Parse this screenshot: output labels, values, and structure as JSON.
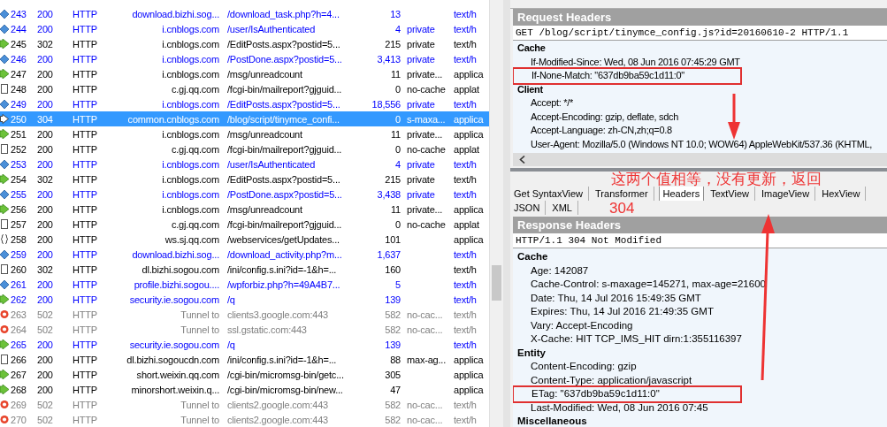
{
  "sessions": {
    "rows": [
      {
        "num": "243",
        "result": "200",
        "protocol": "HTTP",
        "host": "download.bizhi.sog...",
        "url": "/download_task.php?h=4...",
        "body": "13",
        "caching": "",
        "content_type": "text/h",
        "color": "#0000ff",
        "kind": "diamond",
        "selected": false
      },
      {
        "num": "244",
        "result": "200",
        "protocol": "HTTP",
        "host": "i.cnblogs.com",
        "url": "/user/IsAuthenticated",
        "body": "4",
        "caching": "private",
        "content_type": "text/h",
        "color": "#0000ff",
        "kind": "diamond",
        "selected": false
      },
      {
        "num": "245",
        "result": "302",
        "protocol": "HTTP",
        "host": "i.cnblogs.com",
        "url": "/EditPosts.aspx?postid=5...",
        "body": "215",
        "caching": "private",
        "content_type": "text/h",
        "color": "#000000",
        "kind": "green",
        "selected": false
      },
      {
        "num": "246",
        "result": "200",
        "protocol": "HTTP",
        "host": "i.cnblogs.com",
        "url": "/PostDone.aspx?postid=5...",
        "body": "3,413",
        "caching": "private",
        "content_type": "text/h",
        "color": "#0000ff",
        "kind": "diamond",
        "selected": false
      },
      {
        "num": "247",
        "result": "200",
        "protocol": "HTTP",
        "host": "i.cnblogs.com",
        "url": "/msg/unreadcount",
        "body": "11",
        "caching": "private...",
        "content_type": "applica",
        "color": "#000000",
        "kind": "green",
        "selected": false
      },
      {
        "num": "248",
        "result": "200",
        "protocol": "HTTP",
        "host": "c.gj.qq.com",
        "url": "/fcgi-bin/mailreport?gjguid...",
        "body": "0",
        "caching": "no-cache",
        "content_type": "applat",
        "color": "#000000",
        "kind": "page",
        "selected": false
      },
      {
        "num": "249",
        "result": "200",
        "protocol": "HTTP",
        "host": "i.cnblogs.com",
        "url": "/EditPosts.aspx?postid=5...",
        "body": "18,556",
        "caching": "private",
        "content_type": "text/h",
        "color": "#0000ff",
        "kind": "diamond",
        "selected": false
      },
      {
        "num": "250",
        "result": "304",
        "protocol": "HTTP",
        "host": "common.cnblogs.com",
        "url": "/blog/script/tinymce_confi...",
        "body": "0",
        "caching": "s-maxa...",
        "content_type": "applica",
        "kind": "outline",
        "selected": true
      },
      {
        "num": "251",
        "result": "200",
        "protocol": "HTTP",
        "host": "i.cnblogs.com",
        "url": "/msg/unreadcount",
        "body": "11",
        "caching": "private...",
        "content_type": "applica",
        "color": "#000000",
        "kind": "green",
        "selected": false
      },
      {
        "num": "252",
        "result": "200",
        "protocol": "HTTP",
        "host": "c.gj.qq.com",
        "url": "/fcgi-bin/mailreport?gjguid...",
        "body": "0",
        "caching": "no-cache",
        "content_type": "applat",
        "color": "#000000",
        "kind": "page",
        "selected": false
      },
      {
        "num": "253",
        "result": "200",
        "protocol": "HTTP",
        "host": "i.cnblogs.com",
        "url": "/user/IsAuthenticated",
        "body": "4",
        "caching": "private",
        "content_type": "text/h",
        "color": "#0000ff",
        "kind": "diamond",
        "selected": false
      },
      {
        "num": "254",
        "result": "302",
        "protocol": "HTTP",
        "host": "i.cnblogs.com",
        "url": "/EditPosts.aspx?postid=5...",
        "body": "215",
        "caching": "private",
        "content_type": "text/h",
        "color": "#000000",
        "kind": "green",
        "selected": false
      },
      {
        "num": "255",
        "result": "200",
        "protocol": "HTTP",
        "host": "i.cnblogs.com",
        "url": "/PostDone.aspx?postid=5...",
        "body": "3,438",
        "caching": "private",
        "content_type": "text/h",
        "color": "#0000ff",
        "kind": "diamond",
        "selected": false
      },
      {
        "num": "256",
        "result": "200",
        "protocol": "HTTP",
        "host": "i.cnblogs.com",
        "url": "/msg/unreadcount",
        "body": "11",
        "caching": "private...",
        "content_type": "applica",
        "color": "#000000",
        "kind": "green",
        "selected": false
      },
      {
        "num": "257",
        "result": "200",
        "protocol": "HTTP",
        "host": "c.gj.qq.com",
        "url": "/fcgi-bin/mailreport?gjguid...",
        "body": "0",
        "caching": "no-cache",
        "content_type": "applat",
        "color": "#000000",
        "kind": "page",
        "selected": false
      },
      {
        "num": "258",
        "result": "200",
        "protocol": "HTTP",
        "host": "ws.sj.qq.com",
        "url": "/webservices/getUpdates...",
        "body": "101",
        "caching": "",
        "content_type": "applica",
        "color": "#000000",
        "kind": "script",
        "selected": false
      },
      {
        "num": "259",
        "result": "200",
        "protocol": "HTTP",
        "host": "download.bizhi.sog...",
        "url": "/download_activity.php?m...",
        "body": "1,637",
        "caching": "",
        "content_type": "text/h",
        "color": "#0000ff",
        "kind": "diamond",
        "selected": false
      },
      {
        "num": "260",
        "result": "302",
        "protocol": "HTTP",
        "host": "dl.bizhi.sogou.com",
        "url": "/ini/config.s.ini?id=-1&h=...",
        "body": "160",
        "caching": "",
        "content_type": "text/h",
        "color": "#000000",
        "kind": "page",
        "selected": false
      },
      {
        "num": "261",
        "result": "200",
        "protocol": "HTTP",
        "host": "profile.bizhi.sogou....",
        "url": "/wpforbiz.php?h=49A4B7...",
        "body": "5",
        "caching": "",
        "content_type": "text/h",
        "color": "#0000ff",
        "kind": "diamond",
        "selected": false
      },
      {
        "num": "262",
        "result": "200",
        "protocol": "HTTP",
        "host": "security.ie.sogou.com",
        "url": "/q",
        "body": "139",
        "caching": "",
        "content_type": "text/h",
        "color": "#0000ff",
        "kind": "green",
        "selected": false
      },
      {
        "num": "263",
        "result": "502",
        "protocol": "HTTP",
        "host": "Tunnel to",
        "url": "clients3.google.com:443",
        "body": "582",
        "caching": "no-cac...",
        "content_type": "text/h",
        "color": "#808080",
        "kind": "error",
        "selected": false
      },
      {
        "num": "264",
        "result": "502",
        "protocol": "HTTP",
        "host": "Tunnel to",
        "url": "ssl.gstatic.com:443",
        "body": "582",
        "caching": "no-cac...",
        "content_type": "text/h",
        "color": "#808080",
        "kind": "error",
        "selected": false
      },
      {
        "num": "265",
        "result": "200",
        "protocol": "HTTP",
        "host": "security.ie.sogou.com",
        "url": "/q",
        "body": "139",
        "caching": "",
        "content_type": "text/h",
        "color": "#0000ff",
        "kind": "green",
        "selected": false
      },
      {
        "num": "266",
        "result": "200",
        "protocol": "HTTP",
        "host": "dl.bizhi.sogoucdn.com",
        "url": "/ini/config.s.ini?id=-1&h=...",
        "body": "88",
        "caching": "max-ag...",
        "content_type": "applica",
        "color": "#000000",
        "kind": "page",
        "selected": false
      },
      {
        "num": "267",
        "result": "200",
        "protocol": "HTTP",
        "host": "short.weixin.qq.com",
        "url": "/cgi-bin/micromsg-bin/getc...",
        "body": "305",
        "caching": "",
        "content_type": "applica",
        "color": "#000000",
        "kind": "green",
        "selected": false
      },
      {
        "num": "268",
        "result": "200",
        "protocol": "HTTP",
        "host": "minorshort.weixin.q...",
        "url": "/cgi-bin/micromsg-bin/new...",
        "body": "47",
        "caching": "",
        "content_type": "applica",
        "color": "#000000",
        "kind": "green",
        "selected": false
      },
      {
        "num": "269",
        "result": "502",
        "protocol": "HTTP",
        "host": "Tunnel to",
        "url": "clients2.google.com:443",
        "body": "582",
        "caching": "no-cac...",
        "content_type": "text/h",
        "color": "#808080",
        "kind": "error",
        "selected": false
      },
      {
        "num": "270",
        "result": "502",
        "protocol": "HTTP",
        "host": "Tunnel to",
        "url": "clients2.google.com:443",
        "body": "582",
        "caching": "no-cac...",
        "content_type": "text/h",
        "color": "#808080",
        "kind": "error",
        "selected": false
      }
    ]
  },
  "request": {
    "title": "Request Headers",
    "request_line": "GET /blog/script/tinymce_config.js?id=20160610-2 HTTP/1.1",
    "groups": [
      {
        "name": "Cache",
        "headers": [
          {
            "text": "If-Modified-Since: Wed, 08 Jun 2016 07:45:29 GMT",
            "highlighted": false
          },
          {
            "text": "If-None-Match: \"637db9ba59c1d11:0\"",
            "highlighted": true
          }
        ]
      },
      {
        "name": "Client",
        "headers": [
          {
            "text": "Accept: */*",
            "highlighted": false
          },
          {
            "text": "Accept-Encoding: gzip, deflate, sdch",
            "highlighted": false
          },
          {
            "text": "Accept-Language: zh-CN,zh;q=0.8",
            "highlighted": false
          },
          {
            "text": "User-Agent: Mozilla/5.0 (Windows NT 10.0; WOW64) AppleWebKit/537.36 (KHTML,",
            "highlighted": false
          }
        ]
      }
    ]
  },
  "response": {
    "tab_rows": [
      [
        {
          "label": "Get SyntaxView",
          "selected": false
        },
        {
          "label": "Transformer",
          "selected": false
        },
        {
          "label": "Headers",
          "selected": true
        },
        {
          "label": "TextView",
          "selected": false
        },
        {
          "label": "ImageView",
          "selected": false
        },
        {
          "label": "HexView",
          "selected": false
        }
      ],
      [
        {
          "label": "JSON",
          "selected": false
        },
        {
          "label": "XML",
          "selected": false
        }
      ]
    ],
    "title": "Response Headers",
    "status_line": "HTTP/1.1 304 Not Modified",
    "groups": [
      {
        "name": "Cache",
        "headers": [
          {
            "text": "Age: 142087",
            "highlighted": false
          },
          {
            "text": "Cache-Control: s-maxage=145271, max-age=21600",
            "highlighted": false
          },
          {
            "text": "Date: Thu, 14 Jul 2016 15:49:35 GMT",
            "highlighted": false
          },
          {
            "text": "Expires: Thu, 14 Jul 2016 21:49:35 GMT",
            "highlighted": false
          },
          {
            "text": "Vary: Accept-Encoding",
            "highlighted": false
          },
          {
            "text": "X-Cache: HIT TCP_IMS_HIT dirn:1:355116397",
            "highlighted": false
          }
        ]
      },
      {
        "name": "Entity",
        "headers": [
          {
            "text": "Content-Encoding: gzip",
            "highlighted": false
          },
          {
            "text": "Content-Type: application/javascript",
            "highlighted": false
          },
          {
            "text": "ETag: \"637db9ba59c1d11:0\"",
            "highlighted": true
          },
          {
            "text": "Last-Modified: Wed, 08 Jun 2016 07:45",
            "highlighted": false
          }
        ]
      },
      {
        "name": "Miscellaneous"
      }
    ]
  },
  "annotation": {
    "note": "这两个值相等，没有更新，返回",
    "note_2": "304"
  }
}
